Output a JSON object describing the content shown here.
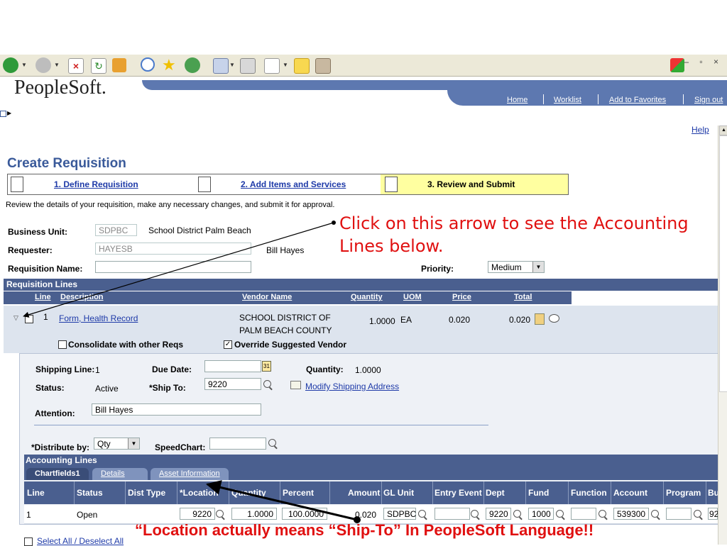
{
  "browser": {
    "window_controls": "– ▫ ×"
  },
  "header": {
    "logo": "PeopleSoft.",
    "links": [
      "Home",
      "Worklist",
      "Add to Favorites",
      "Sign out"
    ],
    "help": "Help"
  },
  "page": {
    "title": "Create Requisition",
    "steps": [
      "1. Define Requisition",
      "2. Add Items and Services",
      "3. Review and Submit"
    ],
    "instruction": "Review the details of your requisition, make any necessary changes, and submit it for approval."
  },
  "form": {
    "business_unit_label": "Business Unit:",
    "business_unit_value": "SDPBC",
    "business_unit_desc": "School District Palm Beach",
    "requester_label": "Requester:",
    "requester_value": "HAYESB",
    "requester_name": "Bill Hayes",
    "req_name_label": "Requisition Name:",
    "req_name_value": "",
    "priority_label": "Priority:",
    "priority_value": "Medium"
  },
  "lines": {
    "section_title": "Requisition Lines",
    "columns": [
      "Line",
      "Description",
      "Vendor Name",
      "Quantity",
      "UOM",
      "Price",
      "Total"
    ],
    "row": {
      "line": "1",
      "description": "Form, Health Record",
      "vendor_line1": "SCHOOL DISTRICT OF",
      "vendor_line2": "PALM BEACH COUNTY",
      "quantity": "1.0000",
      "uom": "EA",
      "price": "0.020",
      "total": "0.020"
    },
    "consolidate_label": "Consolidate with other Reqs",
    "override_label": "Override Suggested Vendor"
  },
  "shipping": {
    "shipping_line_label": "Shipping Line:",
    "shipping_line_value": "1",
    "due_date_label": "Due Date:",
    "quantity_label": "Quantity:",
    "quantity_value": "1.0000",
    "status_label": "Status:",
    "status_value": "Active",
    "ship_to_label": "*Ship To:",
    "ship_to_value": "9220",
    "modify_link": "Modify Shipping Address",
    "attention_label": "Attention:",
    "attention_value": "Bill Hayes",
    "distribute_label": "*Distribute by:",
    "distribute_value": "Qty",
    "speedchart_label": "SpeedChart:"
  },
  "accounting": {
    "title": "Accounting Lines",
    "tabs": [
      "Chartfields1",
      "Details",
      "Asset Information"
    ],
    "columns": [
      "Line",
      "Status",
      "Dist Type",
      "*Location",
      "Quantity",
      "Percent",
      "Amount",
      "GL Unit",
      "Entry Event",
      "Dept",
      "Fund",
      "Function",
      "Account",
      "Program",
      "Bu"
    ],
    "row": {
      "line": "1",
      "status": "Open",
      "dist_type": "",
      "location": "9220",
      "quantity": "1.0000",
      "percent": "100.0000",
      "amount": "0.020",
      "gl_unit": "SDPBC",
      "entry_event": "",
      "dept": "9220",
      "fund": "1000",
      "function": "",
      "account": "539300",
      "program": "",
      "bu": "92"
    }
  },
  "footer": {
    "select_all": "Select All / Deselect All"
  },
  "annotations": {
    "arrow_note_line1": "Click on this arrow to see the Accounting",
    "arrow_note_line2": "Lines below.",
    "location_note": "“Location actually means “Ship-To” In PeopleSoft Language!!"
  },
  "colors": {
    "accent": "#4a5f8f",
    "note": "#e01010",
    "step_active": "#ffffa0",
    "header_band": "#5d78b0"
  }
}
